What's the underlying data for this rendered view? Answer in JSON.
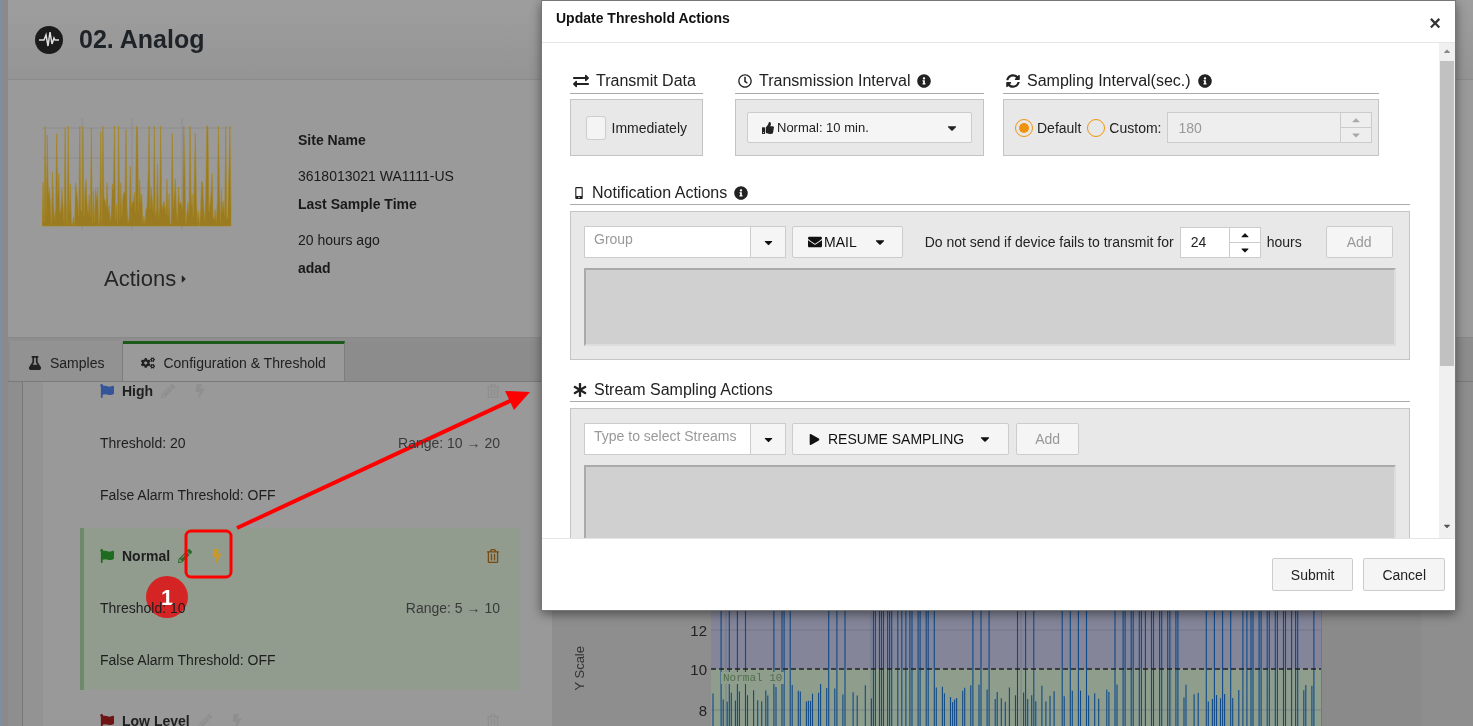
{
  "page": {
    "title": "02. Analog",
    "actions_label": "Actions",
    "info": [
      {
        "kind": "label",
        "text": "Site Name"
      },
      {
        "kind": "value",
        "text": "3618013021 WA1111-US"
      },
      {
        "kind": "label",
        "text": "Last Sample Time"
      },
      {
        "kind": "value",
        "text": "20 hours ago"
      },
      {
        "kind": "label",
        "text": "adad"
      }
    ]
  },
  "tabs": [
    {
      "label": "Samples",
      "kind": "samples",
      "selected": false
    },
    {
      "label": "Configuration & Threshold",
      "kind": "config",
      "selected": true
    }
  ],
  "levels": [
    {
      "name": "High",
      "color": "#34559a",
      "selected": false,
      "threshold": "Threshold: 20",
      "range": "Range: 10 → 20",
      "false_alarm": "False Alarm Threshold: OFF"
    },
    {
      "name": "Normal",
      "color": "#1f6b1f",
      "selected": true,
      "threshold": "Threshold: 10",
      "range": "Range: 5 → 10",
      "false_alarm": "False Alarm Threshold: OFF"
    },
    {
      "name": "Low Level",
      "color": "#6e1414",
      "selected": false
    }
  ],
  "annotation": {
    "number": "1"
  },
  "chart": {
    "y_axis_title": "Y Scale",
    "y_ticks": [
      "12",
      "10",
      "8"
    ],
    "band_label": "Normal 10"
  },
  "dialog": {
    "title": "Update Threshold Actions",
    "close": "×",
    "transmit": {
      "heading": "Transmit Data",
      "option": "Immediately",
      "checked": false
    },
    "interval": {
      "heading": "Transmission Interval",
      "value": "Normal: 10 min."
    },
    "sampling": {
      "heading": "Sampling Interval(sec.)",
      "options": [
        {
          "label": "Default",
          "selected": true
        },
        {
          "label": "Custom:",
          "selected": false
        }
      ],
      "custom_value": "180",
      "custom_disabled": true
    },
    "notification": {
      "heading": "Notification Actions",
      "group_placeholder": "Group",
      "method": "MAIL",
      "note": "Do not send if device fails to transmit for",
      "hours": "24",
      "unit": "hours",
      "add": "Add",
      "add_disabled": true
    },
    "stream": {
      "heading": "Stream Sampling Actions",
      "placeholder": "Type to select Streams",
      "action": "RESUME SAMPLING",
      "add": "Add",
      "add_disabled": true
    },
    "buttons": [
      "Submit",
      "Cancel"
    ]
  }
}
